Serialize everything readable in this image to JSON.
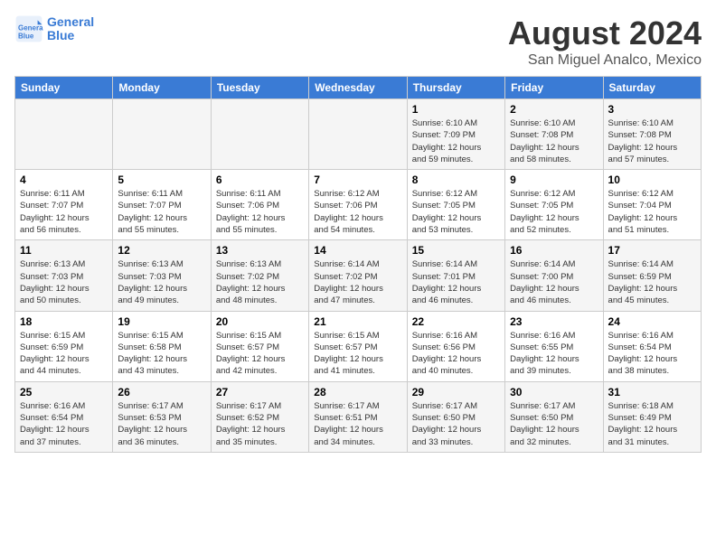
{
  "logo": {
    "line1": "General",
    "line2": "Blue"
  },
  "title": "August 2024",
  "subtitle": "San Miguel Analco, Mexico",
  "days_of_week": [
    "Sunday",
    "Monday",
    "Tuesday",
    "Wednesday",
    "Thursday",
    "Friday",
    "Saturday"
  ],
  "weeks": [
    [
      {
        "day": "",
        "info": ""
      },
      {
        "day": "",
        "info": ""
      },
      {
        "day": "",
        "info": ""
      },
      {
        "day": "",
        "info": ""
      },
      {
        "day": "1",
        "info": "Sunrise: 6:10 AM\nSunset: 7:09 PM\nDaylight: 12 hours\nand 59 minutes."
      },
      {
        "day": "2",
        "info": "Sunrise: 6:10 AM\nSunset: 7:08 PM\nDaylight: 12 hours\nand 58 minutes."
      },
      {
        "day": "3",
        "info": "Sunrise: 6:10 AM\nSunset: 7:08 PM\nDaylight: 12 hours\nand 57 minutes."
      }
    ],
    [
      {
        "day": "4",
        "info": "Sunrise: 6:11 AM\nSunset: 7:07 PM\nDaylight: 12 hours\nand 56 minutes."
      },
      {
        "day": "5",
        "info": "Sunrise: 6:11 AM\nSunset: 7:07 PM\nDaylight: 12 hours\nand 55 minutes."
      },
      {
        "day": "6",
        "info": "Sunrise: 6:11 AM\nSunset: 7:06 PM\nDaylight: 12 hours\nand 55 minutes."
      },
      {
        "day": "7",
        "info": "Sunrise: 6:12 AM\nSunset: 7:06 PM\nDaylight: 12 hours\nand 54 minutes."
      },
      {
        "day": "8",
        "info": "Sunrise: 6:12 AM\nSunset: 7:05 PM\nDaylight: 12 hours\nand 53 minutes."
      },
      {
        "day": "9",
        "info": "Sunrise: 6:12 AM\nSunset: 7:05 PM\nDaylight: 12 hours\nand 52 minutes."
      },
      {
        "day": "10",
        "info": "Sunrise: 6:12 AM\nSunset: 7:04 PM\nDaylight: 12 hours\nand 51 minutes."
      }
    ],
    [
      {
        "day": "11",
        "info": "Sunrise: 6:13 AM\nSunset: 7:03 PM\nDaylight: 12 hours\nand 50 minutes."
      },
      {
        "day": "12",
        "info": "Sunrise: 6:13 AM\nSunset: 7:03 PM\nDaylight: 12 hours\nand 49 minutes."
      },
      {
        "day": "13",
        "info": "Sunrise: 6:13 AM\nSunset: 7:02 PM\nDaylight: 12 hours\nand 48 minutes."
      },
      {
        "day": "14",
        "info": "Sunrise: 6:14 AM\nSunset: 7:02 PM\nDaylight: 12 hours\nand 47 minutes."
      },
      {
        "day": "15",
        "info": "Sunrise: 6:14 AM\nSunset: 7:01 PM\nDaylight: 12 hours\nand 46 minutes."
      },
      {
        "day": "16",
        "info": "Sunrise: 6:14 AM\nSunset: 7:00 PM\nDaylight: 12 hours\nand 46 minutes."
      },
      {
        "day": "17",
        "info": "Sunrise: 6:14 AM\nSunset: 6:59 PM\nDaylight: 12 hours\nand 45 minutes."
      }
    ],
    [
      {
        "day": "18",
        "info": "Sunrise: 6:15 AM\nSunset: 6:59 PM\nDaylight: 12 hours\nand 44 minutes."
      },
      {
        "day": "19",
        "info": "Sunrise: 6:15 AM\nSunset: 6:58 PM\nDaylight: 12 hours\nand 43 minutes."
      },
      {
        "day": "20",
        "info": "Sunrise: 6:15 AM\nSunset: 6:57 PM\nDaylight: 12 hours\nand 42 minutes."
      },
      {
        "day": "21",
        "info": "Sunrise: 6:15 AM\nSunset: 6:57 PM\nDaylight: 12 hours\nand 41 minutes."
      },
      {
        "day": "22",
        "info": "Sunrise: 6:16 AM\nSunset: 6:56 PM\nDaylight: 12 hours\nand 40 minutes."
      },
      {
        "day": "23",
        "info": "Sunrise: 6:16 AM\nSunset: 6:55 PM\nDaylight: 12 hours\nand 39 minutes."
      },
      {
        "day": "24",
        "info": "Sunrise: 6:16 AM\nSunset: 6:54 PM\nDaylight: 12 hours\nand 38 minutes."
      }
    ],
    [
      {
        "day": "25",
        "info": "Sunrise: 6:16 AM\nSunset: 6:54 PM\nDaylight: 12 hours\nand 37 minutes."
      },
      {
        "day": "26",
        "info": "Sunrise: 6:17 AM\nSunset: 6:53 PM\nDaylight: 12 hours\nand 36 minutes."
      },
      {
        "day": "27",
        "info": "Sunrise: 6:17 AM\nSunset: 6:52 PM\nDaylight: 12 hours\nand 35 minutes."
      },
      {
        "day": "28",
        "info": "Sunrise: 6:17 AM\nSunset: 6:51 PM\nDaylight: 12 hours\nand 34 minutes."
      },
      {
        "day": "29",
        "info": "Sunrise: 6:17 AM\nSunset: 6:50 PM\nDaylight: 12 hours\nand 33 minutes."
      },
      {
        "day": "30",
        "info": "Sunrise: 6:17 AM\nSunset: 6:50 PM\nDaylight: 12 hours\nand 32 minutes."
      },
      {
        "day": "31",
        "info": "Sunrise: 6:18 AM\nSunset: 6:49 PM\nDaylight: 12 hours\nand 31 minutes."
      }
    ]
  ]
}
